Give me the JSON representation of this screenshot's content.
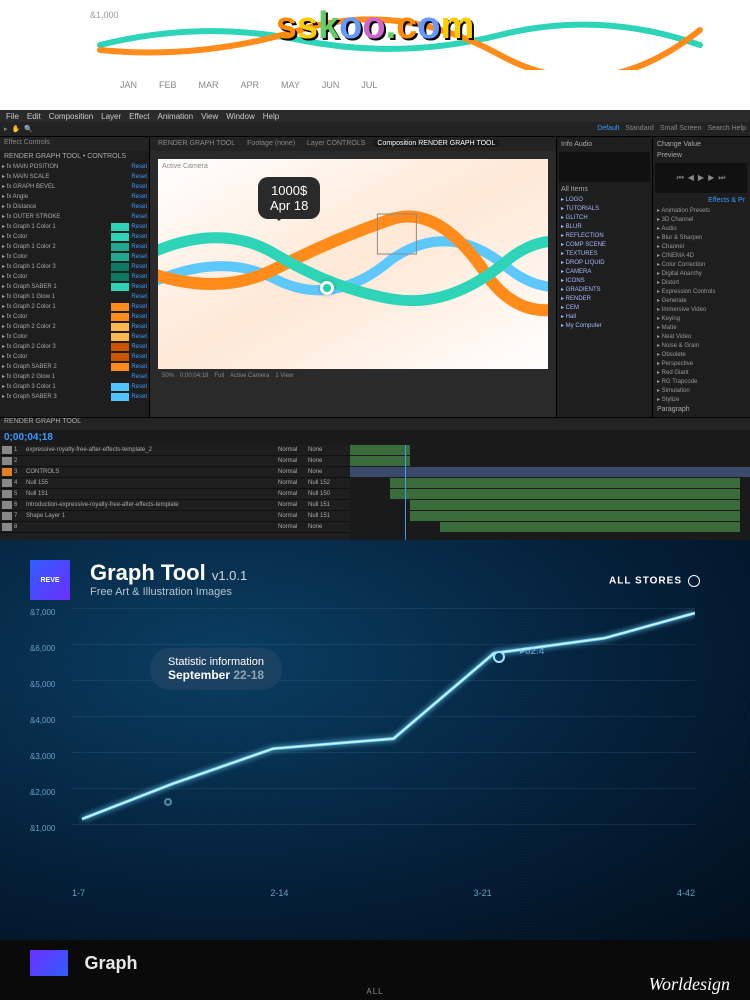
{
  "watermark_text": "sskoo.com",
  "top_chart": {
    "y_label": "&1,000",
    "months": [
      "JAN",
      "FEB",
      "MAR",
      "APR",
      "MAY",
      "JUN",
      "JUL"
    ]
  },
  "ae": {
    "menu": [
      "File",
      "Edit",
      "Composition",
      "Layer",
      "Effect",
      "Animation",
      "View",
      "Window",
      "Help"
    ],
    "toolbar_right": [
      "Default",
      "Standard",
      "Small Screen",
      "Search Help"
    ],
    "left_tabs": [
      "Effect Controls"
    ],
    "panel_title": "RENDER GRAPH TOOL • CONTROLS",
    "effects": [
      {
        "name": "MAIN POSITION",
        "reset": "Reset"
      },
      {
        "name": "MAIN SCALE",
        "reset": "Reset"
      },
      {
        "name": "GRAPH BEVEL",
        "reset": "Reset"
      },
      {
        "name": "Angle",
        "reset": "Reset"
      },
      {
        "name": "Distance",
        "reset": "Reset"
      },
      {
        "name": "OUTER STROKE",
        "reset": "Reset"
      },
      {
        "name": "Graph 1 Color 1",
        "color": "#2dd4b8",
        "reset": "Reset"
      },
      {
        "name": "Color",
        "color": "#2dd4b8",
        "reset": "Reset"
      },
      {
        "name": "Graph 1 Color 2",
        "color": "#1fa88f",
        "reset": "Reset"
      },
      {
        "name": "Color",
        "color": "#1fa88f",
        "reset": "Reset"
      },
      {
        "name": "Graph 1 Color 3",
        "color": "#0d7a65",
        "reset": "Reset"
      },
      {
        "name": "Color",
        "color": "#0d7a65",
        "reset": "Reset"
      },
      {
        "name": "Graph SABER 1",
        "color": "#2dd4b8",
        "reset": "Reset"
      },
      {
        "name": "Graph 1 Glow 1",
        "reset": "Reset"
      },
      {
        "name": "Graph 2 Color 1",
        "color": "#ff8c1a",
        "reset": "Reset"
      },
      {
        "name": "Color",
        "color": "#ff8c1a",
        "reset": "Reset"
      },
      {
        "name": "Graph 2 Color 2",
        "color": "#ffb84d",
        "reset": "Reset"
      },
      {
        "name": "Color",
        "color": "#ffb84d",
        "reset": "Reset"
      },
      {
        "name": "Graph 2 Color 3",
        "color": "#cc5500",
        "reset": "Reset"
      },
      {
        "name": "Color",
        "color": "#cc5500",
        "reset": "Reset"
      },
      {
        "name": "Graph SABER 2",
        "color": "#ff8c1a",
        "reset": "Reset"
      },
      {
        "name": "Graph 2 Glow 1",
        "reset": "Reset"
      },
      {
        "name": "Graph 3 Color 1",
        "color": "#4dc3ff",
        "reset": "Reset"
      },
      {
        "name": "Graph SABER 3",
        "color": "#4dc3ff",
        "reset": "Reset"
      }
    ],
    "comp_tabs": [
      "RENDER GRAPH TOOL",
      "Footage (none)",
      "Layer CONTROLS",
      "Composition RENDER GRAPH TOOL"
    ],
    "canvas_label": "Active Camera",
    "tooltip_value": "1000$",
    "tooltip_date": "Apr 18",
    "viewer_bottom": [
      "50%",
      "0;00;04;18",
      "Full",
      "Active Camera",
      "1 View"
    ],
    "right_tabs": [
      "Info",
      "Audio"
    ],
    "asset_tabs": [
      "All Items"
    ],
    "assets": [
      "LOGO",
      "TUTORIALS",
      "GLITCH",
      "BLUR",
      "REFLECTION",
      "COMP SCENE",
      "TEXTURES",
      "DROP LIQUID",
      "CAMERA",
      "ICONS",
      "GRADIENTS",
      "RENDER",
      "CEM",
      "Hall",
      "My Computer"
    ],
    "change_label": "Change Value",
    "preview_label": "Preview",
    "effects_tab": "Effects & Pr",
    "categories": [
      "Animation Presets",
      "3D Channel",
      "Audio",
      "Blur & Sharpen",
      "Channel",
      "CINEMA 4D",
      "Color Correction",
      "Digital Anarchy",
      "Distort",
      "Expression Controls",
      "Generate",
      "Immersive Video",
      "Keying",
      "Matte",
      "Neat Video",
      "Noise & Grain",
      "Obsolete",
      "Perspective",
      "Red Giant",
      "RG Trapcode",
      "Simulation",
      "Stylize"
    ],
    "paragraph_label": "Paragraph",
    "timeline_tab": "RENDER GRAPH TOOL",
    "timecode": "0;00;04;18",
    "layers": [
      {
        "num": "1",
        "color": "#888",
        "name": "expressive-royalty-free-after-effects-template_2",
        "mode": "Normal",
        "trk": "None"
      },
      {
        "num": "2",
        "color": "#888",
        "name": "",
        "mode": "Normal",
        "trk": "None"
      },
      {
        "num": "3",
        "color": "#e67e22",
        "name": "CONTROLS",
        "mode": "Normal",
        "trk": "None"
      },
      {
        "num": "4",
        "color": "#888",
        "name": "Null 155",
        "mode": "Normal",
        "trk": "Null 152"
      },
      {
        "num": "5",
        "color": "#888",
        "name": "Null 151",
        "mode": "Normal",
        "trk": "Null 150"
      },
      {
        "num": "6",
        "color": "#888",
        "name": "Introduction-expressive-royalty-free-after-effects-template",
        "mode": "Normal",
        "trk": "Null 151"
      },
      {
        "num": "7",
        "color": "#888",
        "name": "Shape Layer 1",
        "mode": "Normal",
        "trk": "Null 151"
      },
      {
        "num": "8",
        "color": "#888",
        "name": "",
        "mode": "Normal",
        "trk": "None"
      }
    ],
    "worldesign": "Worldesign"
  },
  "blue": {
    "logo_text": "REVE",
    "title": "Graph Tool",
    "version": "v1.0.1",
    "subtitle": "Free Art & Illustration Images",
    "allstores": "ALL STORES",
    "stat_line1": "Statistic information",
    "stat_line2_bold": "September",
    "stat_line2_dim": "22-18",
    "point_label": "62.4",
    "y_labels": [
      "&7,000",
      "&6,000",
      "&5,000",
      "&4,000",
      "&3,000",
      "&2,000",
      "&1,000"
    ],
    "x_labels": [
      "1-7",
      "2-14",
      "3-21",
      "4-42"
    ]
  },
  "bottom": {
    "title": "Graph",
    "all_label": "ALL"
  },
  "chart_data": [
    {
      "id": "ae_viewer_curves",
      "type": "line",
      "series": [
        {
          "name": "teal",
          "color": "#2dd4b8"
        },
        {
          "name": "orange",
          "color": "#ff8c1a"
        },
        {
          "name": "cyan",
          "color": "#4dc3ff"
        }
      ],
      "tooltip": {
        "value": "1000$",
        "date": "Apr 18"
      }
    },
    {
      "id": "blue_graph",
      "type": "line",
      "title": "Graph Tool v1.0.1",
      "x_labels": [
        "1-7",
        "2-14",
        "3-21",
        "4-42"
      ],
      "y_range": [
        1000,
        7000
      ],
      "values": [
        1200,
        2800,
        3700,
        5900,
        6300,
        6900
      ],
      "highlight_point_value": 62.4,
      "annotation": "Statistic information — September 22-18"
    }
  ]
}
